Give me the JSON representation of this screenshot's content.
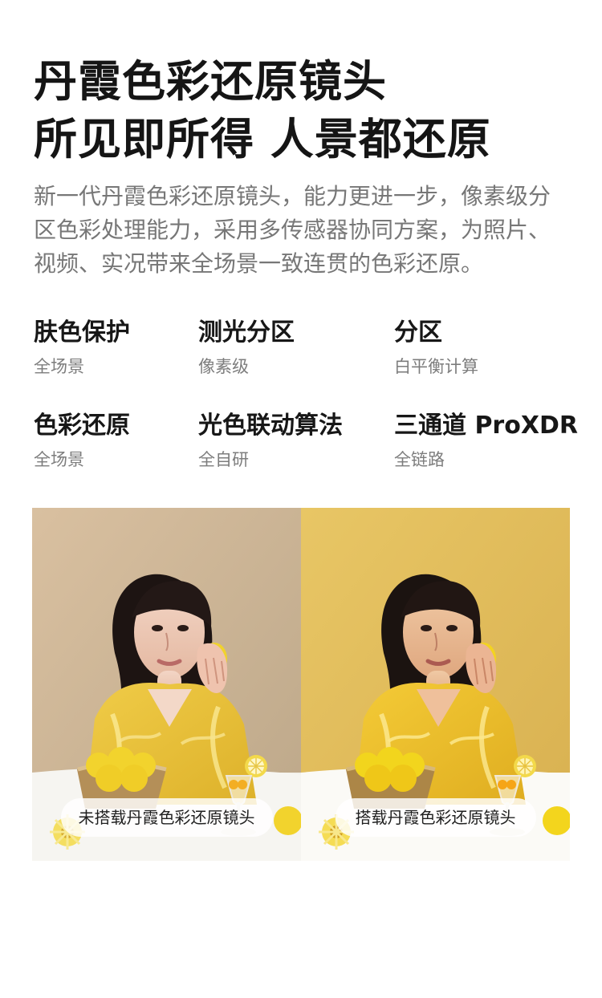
{
  "hero": {
    "line1": "丹霞色彩还原镜头",
    "line2": "所见即所得 人景都还原"
  },
  "intro": {
    "text": "新一代丹霞色彩还原镜头，能力更进一步，像素级分区色彩处理能力，采用多传感器协同方案，为照片、视频、实况带来全场景一致连贯的色彩还原。"
  },
  "features": [
    {
      "title": "肤色保护",
      "subtitle": "全场景"
    },
    {
      "title": "测光分区",
      "subtitle": "像素级"
    },
    {
      "title": "分区",
      "subtitle": "白平衡计算"
    },
    {
      "title": "色彩还原",
      "subtitle": "全场景"
    },
    {
      "title": "光色联动算法",
      "subtitle": "全自研"
    },
    {
      "title": "三通道 ProXDR",
      "subtitle": "全链路"
    }
  ],
  "comparison": {
    "left_label": "未搭载丹霞色彩还原镜头",
    "right_label": "搭载丹霞色彩还原镜头"
  },
  "colors": {
    "title_text": "#151515",
    "body_text": "#777777",
    "left_background": "#cdb497",
    "right_background": "#e2bd62",
    "dress_yellow": "#f0c43a",
    "lemon_yellow": "#f2d431"
  }
}
